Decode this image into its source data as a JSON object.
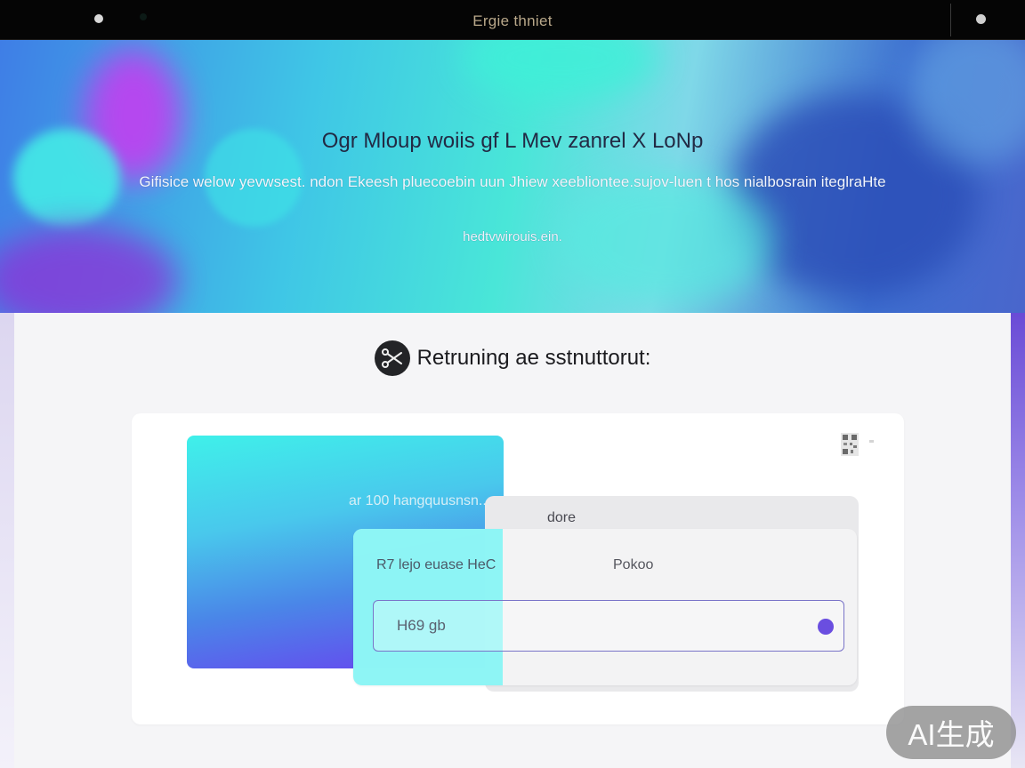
{
  "topbar": {
    "title": "Ergie thniet"
  },
  "hero": {
    "headline": "Ogr Mloup woiis gf L Mev zanrel X LoNp",
    "subline": "Gifisice welow yevwsest. ndon Ekeesh pluecoebin uun Jhiew xeebliontee.sujov-luen t hos nialbosrain iteglraHte",
    "link": "hedtvwirouis.ein."
  },
  "section": {
    "title": "Retruning ae sstnuttorut:",
    "icon": "scissors-icon"
  },
  "form": {
    "faded_label": "ar 100 hangquusnsn...",
    "back_label": "dore",
    "field_label_left": "R7 lejo euase HeC",
    "field_label_right": "Pokoo",
    "input_value": "H69 gb",
    "accent_color": "#6a4ee0"
  },
  "badge": {
    "label": "AI生成"
  }
}
